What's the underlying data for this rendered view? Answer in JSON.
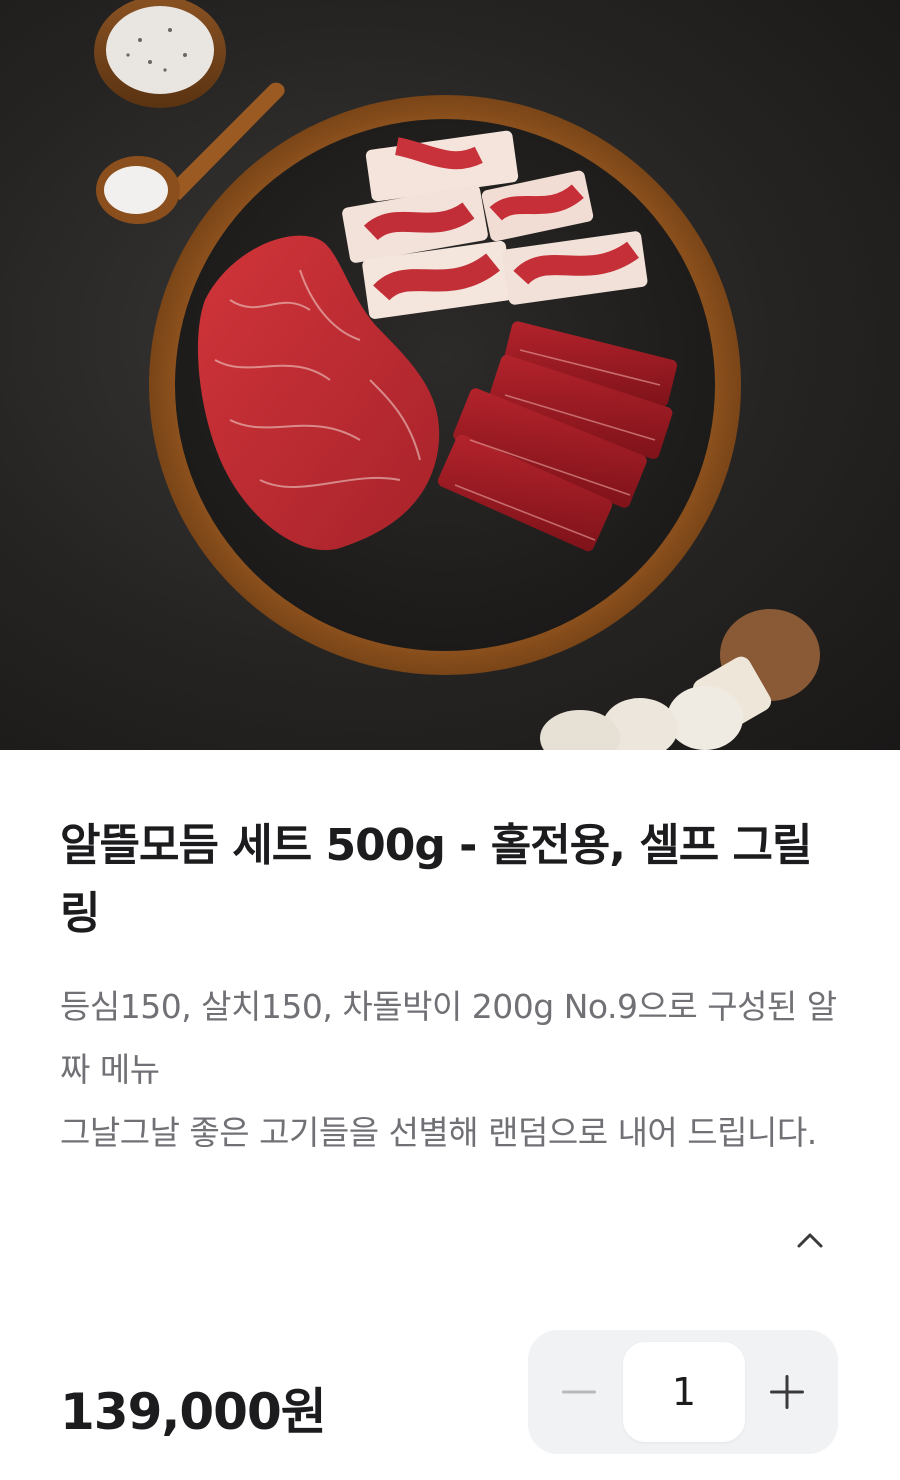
{
  "product": {
    "image_alt": "",
    "title": "알뜰모듬 세트 500g - 홀전용, 셀프 그릴링",
    "description": "등심150, 살치150, 차돌박이 200g   No.9으로 구성된 알짜 메뉴\n그날그날 좋은 고기들을 선별해 랜덤으로 내어 드립니다.",
    "collapse_icon": "chevron-up-icon",
    "price": "139,000원"
  },
  "quantity": {
    "value": "1",
    "minus_icon": "minus-icon",
    "plus_icon": "plus-icon"
  },
  "colors": {
    "text_primary": "#1c1c1e",
    "text_secondary": "#707075",
    "stepper_bg": "#f1f2f4"
  }
}
